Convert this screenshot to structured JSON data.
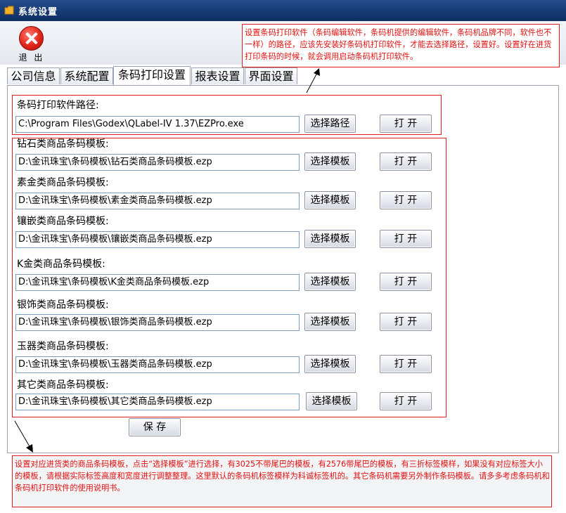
{
  "window": {
    "title": "系统设置"
  },
  "toolbar": {
    "exit_label": "退 出"
  },
  "notes": {
    "top": "设置条码打印软件（条码编辑软件，条码机提供的编辑软件，条码机品牌不同，软件也不一样）的路径，应该先安装好条码机打印软件，才能去选择路径，设置好。设置好在进货打印条码的时候，就会调用启动条码机打印软件。",
    "bottom": "设置对应进货类的商品条码模板，点击“选择模板”进行选择，有3025不带尾巴的模板，有2576带尾巴的模板，有三折标签模样，如果没有对应标签大小的模板，请根据实际标签高度和宽度进行调整整理。这里默认的条码机标签模样为科诚标签机的。其它条码机需要另外制作条码模板。请多多考虑条码机和条码机打印软件的使用说明书。"
  },
  "tabs": [
    {
      "label": "公司信息"
    },
    {
      "label": "系统配置"
    },
    {
      "label": "条码打印设置"
    },
    {
      "label": "报表设置"
    },
    {
      "label": "界面设置"
    }
  ],
  "active_tab": "条码打印设置",
  "printer": {
    "label": "条码打印软件路径:",
    "value": "C:\\Program Files\\Godex\\QLabel-IV 1.37\\EZPro.exe",
    "select_label": "选择路径",
    "open_label": "打 开"
  },
  "templates": [
    {
      "label": "钻石类商品条码模板:",
      "value": "D:\\金讯珠宝\\条码模板\\钻石类商品条码模板.ezp",
      "select_label": "选择模板",
      "open_label": "打 开"
    },
    {
      "label": "素金类商品条码模板:",
      "value": "D:\\金讯珠宝\\条码模板\\素金类商品条码模板.ezp",
      "select_label": "选择模板",
      "open_label": "打 开"
    },
    {
      "label": "镶嵌类商品条码模板:",
      "value": "D:\\金讯珠宝\\条码模板\\镶嵌类商品条码模板.ezp",
      "select_label": "选择模板",
      "open_label": "打 开"
    },
    {
      "label": "K金类商品条码模板:",
      "value": "D:\\金讯珠宝\\条码模板\\K金类商品条码模板.ezp",
      "select_label": "选择模板",
      "open_label": "打 开"
    },
    {
      "label": "银饰类商品条码模板:",
      "value": "D:\\金讯珠宝\\条码模板\\银饰类商品条码模板.ezp",
      "select_label": "选择模板",
      "open_label": "打 开"
    },
    {
      "label": "玉器类商品条码模板:",
      "value": "D:\\金讯珠宝\\条码模板\\玉器类商品条码模板.ezp",
      "select_label": "选择模板",
      "open_label": "打 开"
    },
    {
      "label": "其它类商品条码模板:",
      "value": "D:\\金讯珠宝\\条码模板\\其它类商品条码模板.ezp",
      "select_label": "选择模板",
      "open_label": "打 开"
    }
  ],
  "save_label": "保 存",
  "colors": {
    "titlebar": "#163a72",
    "annotation": "#e02020",
    "field_border": "#7f9db9"
  }
}
